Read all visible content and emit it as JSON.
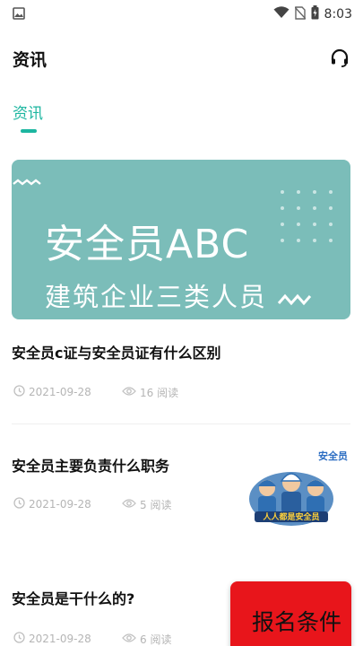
{
  "status_bar": {
    "time": "8:03",
    "icons": [
      "image-icon",
      "wifi-icon",
      "no-sim-icon",
      "battery-icon"
    ]
  },
  "header": {
    "title": "资讯",
    "support_icon": "headset-icon"
  },
  "tabs": [
    {
      "label": "资讯",
      "active": true
    }
  ],
  "banner": {
    "main_text": "安全员ABC",
    "sub_text": "建筑企业三类人员",
    "bg_color": "#7bbdb9"
  },
  "articles": [
    {
      "title": "安全员c证与安全员证有什么区别",
      "date": "2021-09-28",
      "reads": "16 阅读"
    },
    {
      "title": "安全员主要负责什么职务",
      "date": "2021-09-28",
      "reads": "5 阅读",
      "thumb_label": "安全员",
      "thumb_caption": "人人都是安全员"
    },
    {
      "title": "安全员是干什么的?",
      "date": "2021-09-28",
      "reads": "6 阅读"
    }
  ],
  "signup": {
    "label": "报名条件",
    "color": "#e8151b"
  },
  "accent_color": "#1cb6a0"
}
